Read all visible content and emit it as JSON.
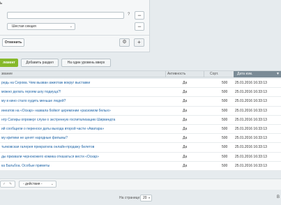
{
  "filter": {
    "title_fragment": "ь",
    "question_mark": "?",
    "minus_symbol": "−",
    "section_select": "Шестая секция",
    "cancel_label": "Отменить",
    "plus_symbol": "+"
  },
  "toolbar": {
    "add_element_label": "лемент",
    "add_section_label": "Добавить раздел",
    "level_up_label": "На один уровень вверх"
  },
  "table": {
    "headers": {
      "name": "звание",
      "activity": "Активность",
      "sort": "Сорт.",
      "date": "Дата изм."
    },
    "rows": [
      {
        "name": "редь на Серова. Чем вызван ажиотаж вокруг выставки",
        "active": "Да",
        "sort": "500",
        "date": "25.01.2016 16:33:13"
      },
      {
        "name": "можно делать героям шоу подиуца?!",
        "active": "Да",
        "sort": "500",
        "date": "25.01.2016 16:33:13"
      },
      {
        "name": "му в кино стало худить меньше людей?",
        "active": "Да",
        "sort": "500",
        "date": "25.01.2016 16:33:13"
      },
      {
        "name": "инеатов на «Оскар» назвала бойкот церемонии «расизмом белых»",
        "active": "Да",
        "sort": "500",
        "date": "25.01.2016 16:33:13"
      },
      {
        "name": "нтр Сатиры опроверг слухи о экстренную госпитализацию Ширвиндта",
        "active": "Да",
        "sort": "500",
        "date": "25.01.2016 16:33:13"
      },
      {
        "name": "ий сообщили о переносе даты выхода второй части «Аватара»",
        "active": "Да",
        "sort": "500",
        "date": "25.01.2016 16:33:13"
      },
      {
        "name": "му критики не ценят народные фильмы?",
        "active": "Да",
        "sort": "500",
        "date": "25.01.2016 16:33:13"
      },
      {
        "name": "тьяковская галерея прекратила онлайн-продажу билетов",
        "active": "Да",
        "sort": "500",
        "date": "25.01.2016 16:33:13"
      },
      {
        "name": "ды призвали чернокожего комика отказаться вести «Оскар»",
        "active": "Да",
        "sort": "500",
        "date": "25.01.2016 16:33:13"
      },
      {
        "name": "ка Бальбоа. Особые приметы",
        "active": "Да",
        "sort": "500",
        "date": "25.01.2016 16:33:13"
      }
    ]
  },
  "footer": {
    "actions_select": "- действия -",
    "per_page_label": "На странице:",
    "per_page_value": "20",
    "right_fragment": "В"
  },
  "colors": {
    "accent_green": "#86b82a",
    "link_blue": "#2066a8",
    "sorted_header": "#7a8b96"
  }
}
